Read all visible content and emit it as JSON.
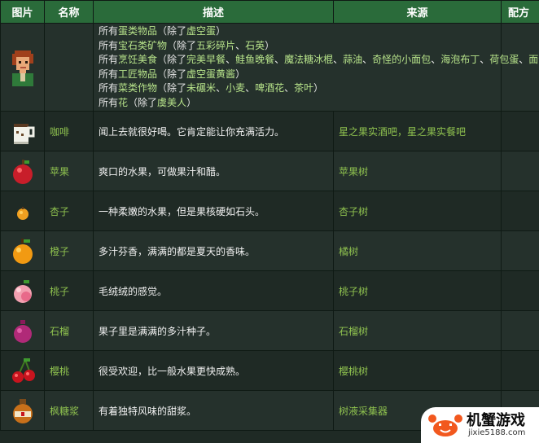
{
  "header": {
    "image": "图片",
    "name": "名称",
    "desc": "描述",
    "source": "来源",
    "recipe": "配方"
  },
  "first_row": {
    "icon": "villager-portrait-icon",
    "lines": [
      [
        {
          "t": "所有",
          "c": "w"
        },
        {
          "t": "蛋类物品",
          "c": "g"
        },
        {
          "t": "（除了",
          "c": "w"
        },
        {
          "t": "虚空蛋",
          "c": "g"
        },
        {
          "t": "）",
          "c": "w"
        }
      ],
      [
        {
          "t": "所有",
          "c": "w"
        },
        {
          "t": "宝石类矿物",
          "c": "g"
        },
        {
          "t": "（除了",
          "c": "w"
        },
        {
          "t": "五彩碎片",
          "c": "g"
        },
        {
          "t": "、",
          "c": "w"
        },
        {
          "t": "石英",
          "c": "g"
        },
        {
          "t": "）",
          "c": "w"
        }
      ],
      [
        {
          "t": "所有",
          "c": "w"
        },
        {
          "t": "烹饪美食",
          "c": "g"
        },
        {
          "t": "（除了",
          "c": "w"
        },
        {
          "t": "完美早餐",
          "c": "g"
        },
        {
          "t": "、",
          "c": "w"
        },
        {
          "t": "鲑鱼晚餐",
          "c": "g"
        },
        {
          "t": "、",
          "c": "w"
        },
        {
          "t": "魔法糖冰棍",
          "c": "g"
        },
        {
          "t": "、",
          "c": "w"
        },
        {
          "t": "蒜油",
          "c": "g"
        },
        {
          "t": "、",
          "c": "w"
        },
        {
          "t": "奇怪的小面包",
          "c": "g"
        },
        {
          "t": "、",
          "c": "w"
        },
        {
          "t": "海泡布丁",
          "c": "g"
        },
        {
          "t": "、",
          "c": "w"
        },
        {
          "t": "荷包蛋",
          "c": "g"
        },
        {
          "t": "、",
          "c": "w"
        },
        {
          "t": "面包",
          "c": "g"
        },
        {
          "t": "）",
          "c": "w"
        }
      ],
      [
        {
          "t": "所有",
          "c": "w"
        },
        {
          "t": "工匠物品",
          "c": "g"
        },
        {
          "t": "（除了",
          "c": "w"
        },
        {
          "t": "虚空蛋黄酱",
          "c": "g"
        },
        {
          "t": "）",
          "c": "w"
        }
      ],
      [
        {
          "t": "所有",
          "c": "w"
        },
        {
          "t": "菜类作物",
          "c": "g"
        },
        {
          "t": "（除了",
          "c": "w"
        },
        {
          "t": "未碾米",
          "c": "g"
        },
        {
          "t": "、",
          "c": "w"
        },
        {
          "t": "小麦",
          "c": "g"
        },
        {
          "t": "、",
          "c": "w"
        },
        {
          "t": "啤酒花",
          "c": "g"
        },
        {
          "t": "、",
          "c": "w"
        },
        {
          "t": "茶叶",
          "c": "g"
        },
        {
          "t": "）",
          "c": "w"
        }
      ],
      [
        {
          "t": "所有",
          "c": "w"
        },
        {
          "t": "花",
          "c": "g"
        },
        {
          "t": "（除了",
          "c": "w"
        },
        {
          "t": "虞美人",
          "c": "g"
        },
        {
          "t": "）",
          "c": "w"
        }
      ]
    ]
  },
  "items": [
    {
      "icon": "coffee-cup-icon",
      "name": "咖啡",
      "desc": "闻上去就很好喝。它肯定能让你充满活力。",
      "source": "星之果实酒吧，星之果实餐吧"
    },
    {
      "icon": "apple-icon",
      "name": "苹果",
      "desc": "爽口的水果，可做果汁和醋。",
      "source": "苹果树"
    },
    {
      "icon": "apricot-icon",
      "name": "杏子",
      "desc": "一种柔嫩的水果，但是果核硬如石头。",
      "source": "杏子树"
    },
    {
      "icon": "orange-icon",
      "name": "橙子",
      "desc": "多汁芬香，满满的都是夏天的香味。",
      "source": "橘树"
    },
    {
      "icon": "peach-icon",
      "name": "桃子",
      "desc": "毛绒绒的感觉。",
      "source": "桃子树"
    },
    {
      "icon": "pomegranate-icon",
      "name": "石榴",
      "desc": "果子里是满满的多汁种子。",
      "source": "石榴树"
    },
    {
      "icon": "cherry-icon",
      "name": "樱桃",
      "desc": "很受欢迎，比一般水果更快成熟。",
      "source": "樱桃树"
    },
    {
      "icon": "maple-syrup-icon",
      "name": "枫糖浆",
      "desc": "有着独特风味的甜浆。",
      "source": "树液采集器"
    }
  ],
  "watermark": {
    "title": "机蟹游戏",
    "url": "jixie5188.com",
    "icon": "crab-logo-icon"
  },
  "colors": {
    "header_bg": "#2a6b3a",
    "row_bg": "#1f2a25",
    "row_alt_bg": "#25312c",
    "link_green": "#8fc24f"
  }
}
